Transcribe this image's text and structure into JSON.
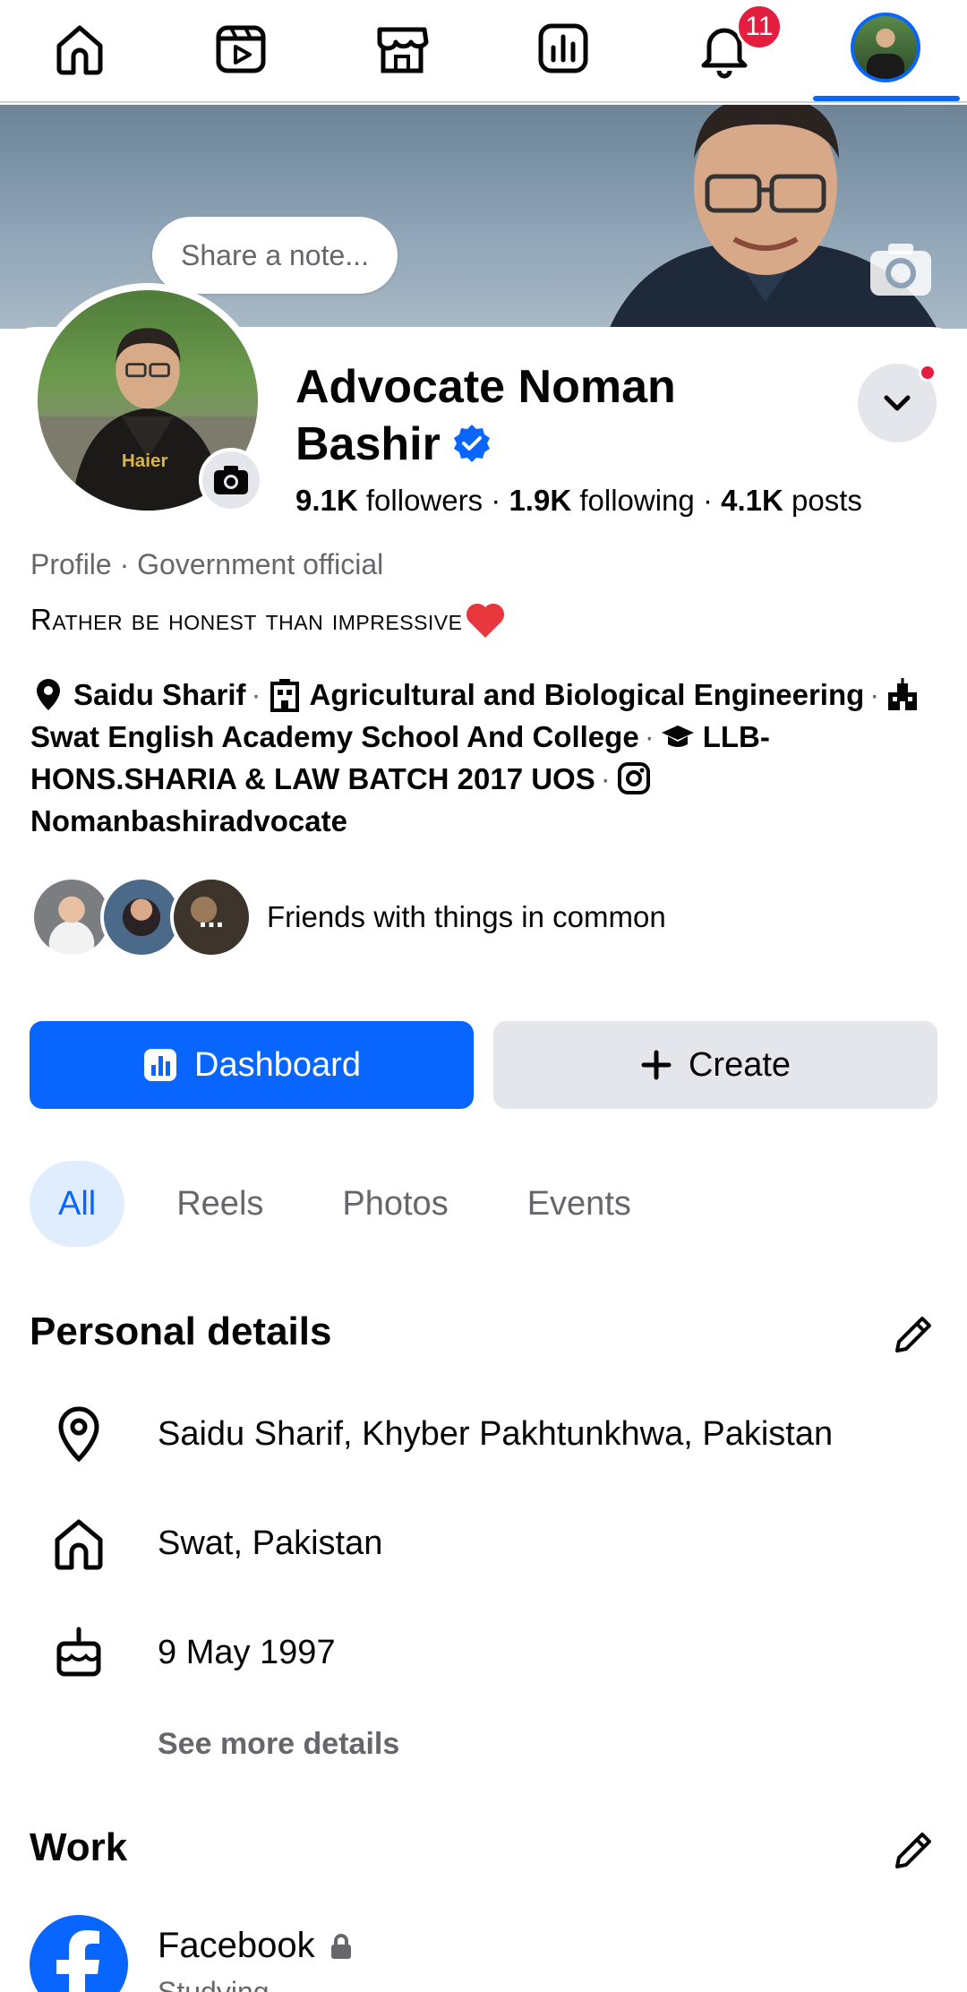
{
  "nav": {
    "items": [
      {
        "name": "home-icon"
      },
      {
        "name": "video-icon"
      },
      {
        "name": "marketplace-icon"
      },
      {
        "name": "dashboard-icon"
      },
      {
        "name": "notifications-icon"
      },
      {
        "name": "profile-avatar"
      }
    ],
    "notification_count": "11",
    "active_color": "#0866ff"
  },
  "cover": {
    "note_placeholder": "Share a note..."
  },
  "profile": {
    "name": "Advocate Noman Bashir",
    "verified": true,
    "followers_count": "9.1K",
    "followers_label": "followers",
    "following_count": "1.9K",
    "following_label": "following",
    "posts_count": "4.1K",
    "posts_label": "posts",
    "category": "Profile · Government official",
    "bio": "Rather be honest than impressive"
  },
  "intro": {
    "location": "Saidu Sharif",
    "work": "Agricultural and Biological Engineering",
    "school": "Swat English Academy School And College",
    "education": "LLB-HONS.SHARIA & LAW BATCH 2017 UOS",
    "instagram": "Nomanbashiradvocate"
  },
  "friends": {
    "more_label": "...",
    "text": "Friends with things in common"
  },
  "actions": {
    "dashboard_label": "Dashboard",
    "create_label": "Create"
  },
  "tabs": [
    {
      "label": "All",
      "active": true
    },
    {
      "label": "Reels",
      "active": false
    },
    {
      "label": "Photos",
      "active": false
    },
    {
      "label": "Events",
      "active": false
    }
  ],
  "personal_details": {
    "title": "Personal details",
    "current_city": "Saidu Sharif, Khyber Pakhtunkhwa, Pakistan",
    "hometown": "Swat, Pakistan",
    "birthday": "9 May 1997",
    "see_more_label": "See more details"
  },
  "work": {
    "title": "Work",
    "company": "Facebook",
    "subtitle": "Studying"
  },
  "colors": {
    "primary": "#0866ff",
    "badge": "#e41e3f",
    "secondary_bg": "#e4e6eb",
    "muted_text": "#65676b"
  }
}
